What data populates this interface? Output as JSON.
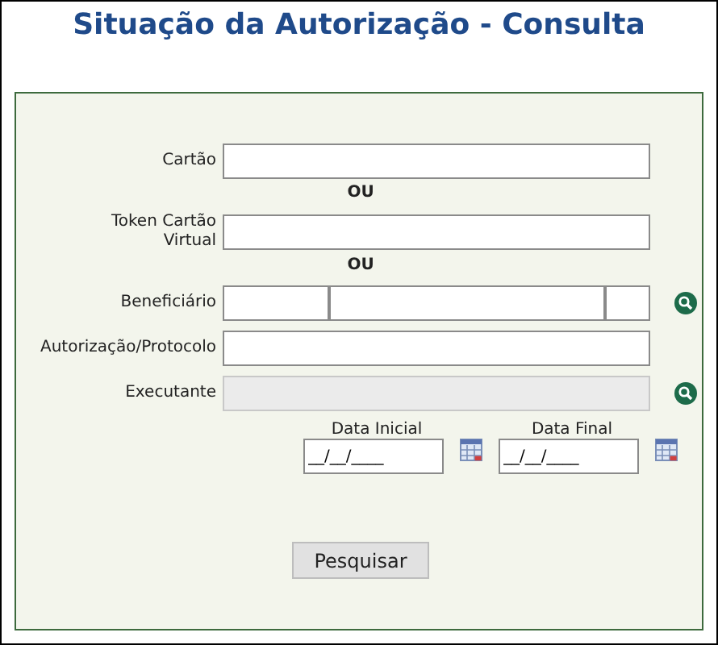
{
  "title": "Situação da Autorização - Consulta",
  "fields": [
    {
      "kind": "text",
      "label": "Cartão",
      "disabled": false,
      "lookup": false
    },
    {
      "kind": "separator",
      "label": "OU"
    },
    {
      "kind": "text",
      "label": "Token Cartão Virtual",
      "disabled": false,
      "lookup": false
    },
    {
      "kind": "separator",
      "label": "OU"
    },
    {
      "kind": "split",
      "label": "Beneficiário",
      "disabled": false,
      "lookup": true
    },
    {
      "kind": "text",
      "label": "Autorização/Protocolo",
      "disabled": false,
      "lookup": false
    },
    {
      "kind": "text",
      "label": "Executante",
      "disabled": true,
      "lookup": true
    }
  ],
  "dates": [
    {
      "label": "Data Inicial",
      "value": "__/__/____"
    },
    {
      "label": "Data Final",
      "value": "__/__/____"
    }
  ],
  "button": "Pesquisar"
}
